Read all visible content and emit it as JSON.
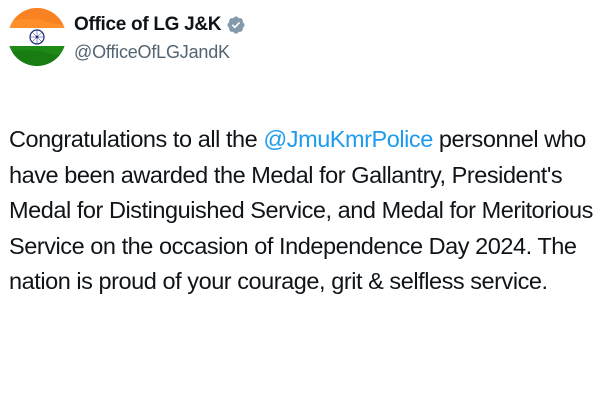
{
  "author": {
    "display_name": "Office of LG J&K",
    "handle": "@OfficeOfLGJandK",
    "verified_icon": "verified-badge-icon",
    "avatar_icon": "indian-flag-avatar",
    "badge_color": "#829aab"
  },
  "tweet": {
    "text_before_mention": "Congratulations to all the ",
    "mention": "@JmuKmrPolice",
    "text_after_mention": " personnel who have been awarded the Medal for Gallantry, President's Medal for Distinguished Service, and Medal for Meritorious Service on the occasion of Independence Day 2024. The nation is proud of your courage, grit & selfless service."
  },
  "colors": {
    "text": "#0f1419",
    "secondary_text": "#536471",
    "mention": "#1d9bf0",
    "saffron": "#ff9933",
    "green": "#138808"
  }
}
